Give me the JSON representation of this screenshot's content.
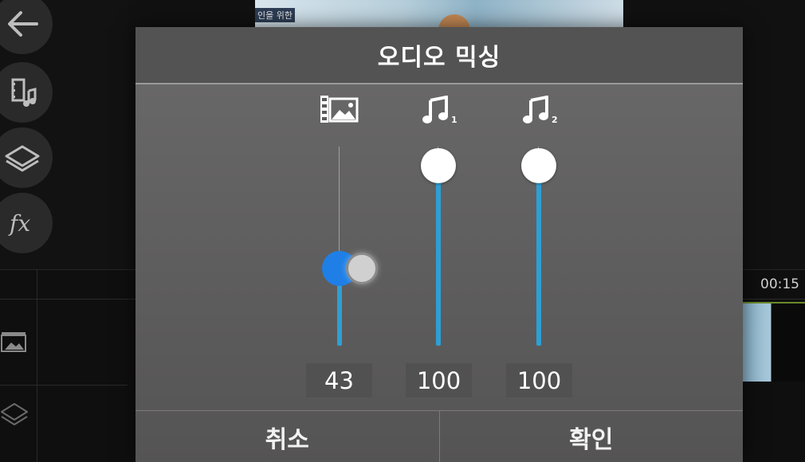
{
  "dialog": {
    "title": "오디오 믹싱",
    "cancel_label": "취소",
    "confirm_label": "확인"
  },
  "channels": [
    {
      "icon": "video-clip-icon",
      "value": "43",
      "level": 43,
      "state": "dragging"
    },
    {
      "icon": "music-track-1-icon",
      "subscript": "1",
      "value": "100",
      "level": 100,
      "state": "idle"
    },
    {
      "icon": "music-track-2-icon",
      "subscript": "2",
      "value": "100",
      "level": 100,
      "state": "idle"
    }
  ],
  "background": {
    "timeline_time": "00:15",
    "preview_caption": "인을 위한",
    "rail_icons": [
      "back-arrow-icon",
      "media-music-icon",
      "layers-icon",
      "fx-icon"
    ]
  },
  "colors": {
    "accent": "#2e9fd4",
    "active_knob": "#1f7fe6",
    "dialog_bg": "#626161",
    "header_bg": "#545353"
  }
}
